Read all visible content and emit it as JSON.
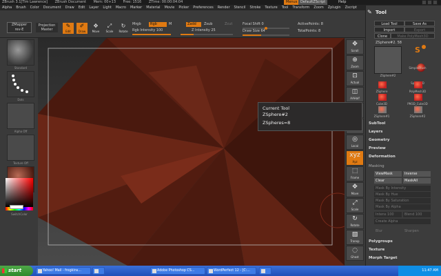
{
  "titlebar": {
    "app": "ZBrush 3.1[Tim Lawrence]",
    "document": "ZBrush Document",
    "mem": "Mem: 00+13",
    "free": "Free: 1516",
    "ztime": "ZTime: 00:00:04:04",
    "menus_btn": "Menus",
    "script_btn": "DefaultZScript",
    "help_btn": "Help"
  },
  "menubar": [
    "Alpha",
    "Brush",
    "Color",
    "Document",
    "Draw",
    "Edit",
    "Layer",
    "Light",
    "Macro",
    "Marker",
    "Material",
    "Movie",
    "Picker",
    "Preferences",
    "Render",
    "Stencil",
    "Stroke",
    "Texture",
    "Tool",
    "Transform",
    "Zoom",
    "Zplugin",
    "Zscript"
  ],
  "toolbar": {
    "zmapper_line1": "ZMapper",
    "zmapper_line2": "rev-E",
    "projection_line1": "Projection",
    "projection_line2": "Master",
    "edit": "Edit",
    "draw": "Draw",
    "move": "Move",
    "scale": "Scale",
    "rotate": "Rotate",
    "mrgb": "Mrgb",
    "rgb": "Rgb",
    "m": "M",
    "rgb_intensity": "Rgb Intensity 100",
    "zadd": "Zadd",
    "zsub": "Zsub",
    "zcut": "Zcut",
    "z_intensity": "Z Intensity 25",
    "focal_shift": "Focal Shift 0",
    "draw_size": "Draw Size 64",
    "active_points": "ActivePoints: 8",
    "total_points": "TotalPoints: 8",
    "rgb_intensity_value": 1.0,
    "z_intensity_value": 0.25,
    "draw_size_value": 0.4
  },
  "leftshelf": {
    "brush_label": "Standard",
    "stroke_label": "Dots",
    "alpha_label": "Alpha Off",
    "texture_label": "Texture Off",
    "material_label": "Matcap Red Wax",
    "switch_label": "SwitchColor",
    "primary_color": "#ffffff",
    "secondary_color": "#000000"
  },
  "rightshelf": [
    "Scroll",
    "Zoom",
    "Actual",
    "AAHalf",
    "Persp",
    "Floor",
    "Local",
    "Xyz",
    "Frame",
    "Move",
    "Scale",
    "Rotate",
    "Transp",
    "Ghost"
  ],
  "tooltip": {
    "line1": "Current Tool",
    "line2": "ZSphere#2",
    "line3": "ZSpheres=8"
  },
  "palette": {
    "title": "Tool",
    "load_tool": "Load Tool",
    "save_as": "Save As",
    "import": "Import",
    "export": "Export",
    "clone": "Clone",
    "make_polymesh": "Make PolyMesh3D",
    "current_tool": "ZSphere#2. 58",
    "current_name": "ZSphere#2",
    "tools": [
      {
        "name": "SimpleBrush"
      },
      {
        "name": "Sphere3D"
      },
      {
        "name": "ZSphere"
      },
      {
        "name": "PolyMesh3D"
      },
      {
        "name": "Cube3D"
      },
      {
        "name": "PM3D_Cube3D"
      },
      {
        "name": "ZSphere#1"
      },
      {
        "name": "ZSphere#2"
      }
    ],
    "sections_top": [
      "SubTool",
      "Layers",
      "Geometry",
      "Preview",
      "Deformation"
    ],
    "masking": "Masking",
    "viewmask": "ViewMask",
    "inverse": "Inverse",
    "clear": "Clear",
    "maskall": "MaskAll",
    "mask_rows": [
      "Mask By Intensity",
      "Mask By Hue",
      "Mask By Saturation",
      "Mask By Alpha"
    ],
    "intens": "Intens 100",
    "blend": "Blend 100",
    "create_alpha": "Create Alpha",
    "blur_left": "Blur",
    "sharpen": "Sharpen",
    "sections_bottom": [
      "Polygroups",
      "Texture",
      "Morph Target"
    ]
  },
  "taskbar": {
    "start": "start",
    "tasks": [
      "Yahoo! Mail - frogkins...",
      "",
      "Adobe Photoshop CS...",
      "WordPerfect 12 - [C:...",
      ""
    ],
    "clock": "11:47 AM"
  },
  "colors": {
    "accent": "#e07a12",
    "model": "#5a1f12"
  }
}
